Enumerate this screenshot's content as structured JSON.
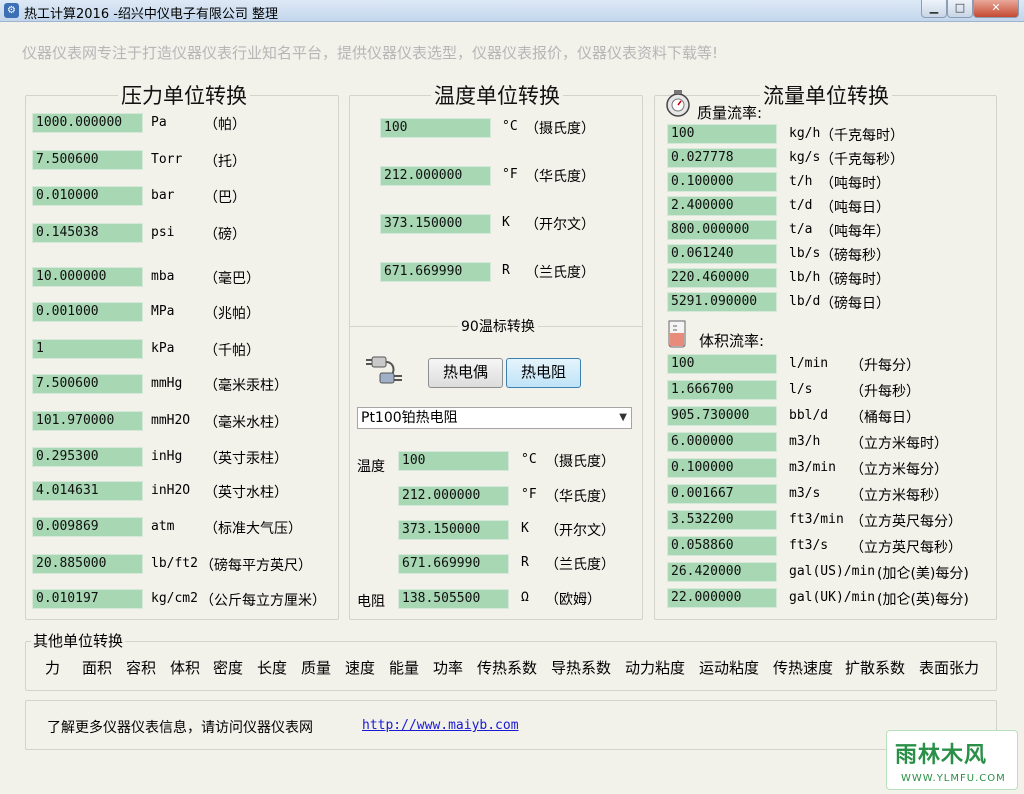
{
  "window": {
    "title": "热工计算2016 -绍兴中仪电子有限公司 整理",
    "app_icon": "gauge-app-icon"
  },
  "tagline": "仪器仪表网专注于打造仪器仪表行业知名平台，提供仪器仪表选型，仪器仪表报价，仪器仪表资料下载等!",
  "pressure": {
    "title": "压力单位转换",
    "rows": [
      {
        "value": "1000.000000",
        "unit": "Pa",
        "name": "（帕）"
      },
      {
        "value": "7.500600",
        "unit": "Torr",
        "name": "（托）"
      },
      {
        "value": "0.010000",
        "unit": "bar",
        "name": "（巴）"
      },
      {
        "value": "0.145038",
        "unit": "psi",
        "name": "（磅）"
      },
      {
        "value": "10.000000",
        "unit": "mba",
        "name": "（毫巴）"
      },
      {
        "value": "0.001000",
        "unit": "MPa",
        "name": "（兆帕）"
      },
      {
        "value": "1",
        "unit": "kPa",
        "name": "（千帕）"
      },
      {
        "value": "7.500600",
        "unit": "mmHg",
        "name": "（毫米汞柱）"
      },
      {
        "value": "101.970000",
        "unit": "mmH2O",
        "name": "（毫米水柱）"
      },
      {
        "value": "0.295300",
        "unit": "inHg",
        "name": "（英寸汞柱）"
      },
      {
        "value": "4.014631",
        "unit": "inH2O",
        "name": "（英寸水柱）"
      },
      {
        "value": "0.009869",
        "unit": "atm",
        "name": "（标准大气压）"
      },
      {
        "value": "20.885000",
        "unit": "lb/ft2",
        "name": "（磅每平方英尺）"
      },
      {
        "value": "0.010197",
        "unit": "kg/cm2",
        "name": "（公斤每立方厘米）"
      }
    ]
  },
  "temperature": {
    "title": "温度单位转换",
    "rows": [
      {
        "value": "100",
        "unit": "°C",
        "name": "（摄氏度）"
      },
      {
        "value": "212.000000",
        "unit": "°F",
        "name": "（华氏度）"
      },
      {
        "value": "373.150000",
        "unit": "K",
        "name": "（开尔文）"
      },
      {
        "value": "671.669990",
        "unit": "R",
        "name": "（兰氏度）"
      }
    ],
    "its90": {
      "title": "90温标转换",
      "icon": "sensor-plug-icon",
      "btn_thermocouple": "热电偶",
      "btn_rtd": "热电阻",
      "sensor_select": "Pt100铂热电阻",
      "temp_label": "温度",
      "resistance_label": "电阻",
      "rows": [
        {
          "value": "100",
          "unit": "°C",
          "name": "（摄氏度）"
        },
        {
          "value": "212.000000",
          "unit": "°F",
          "name": "（华氏度）"
        },
        {
          "value": "373.150000",
          "unit": "K",
          "name": "（开尔文）"
        },
        {
          "value": "671.669990",
          "unit": "R",
          "name": "（兰氏度）"
        },
        {
          "value": "138.505500",
          "unit": "Ω",
          "name": "（欧姆）"
        }
      ]
    }
  },
  "flow": {
    "title": "流量单位转换",
    "mass_label": "质量流率:",
    "mass_icon": "scale-icon",
    "mass_rows": [
      {
        "value": "100",
        "unit": "kg/h",
        "name": "（千克每时）"
      },
      {
        "value": "0.027778",
        "unit": "kg/s",
        "name": "（千克每秒）"
      },
      {
        "value": "0.100000",
        "unit": "t/h",
        "name": "（吨每时）"
      },
      {
        "value": "2.400000",
        "unit": "t/d",
        "name": "（吨每日）"
      },
      {
        "value": "800.000000",
        "unit": "t/a",
        "name": "（吨每年）"
      },
      {
        "value": "0.061240",
        "unit": "lb/s",
        "name": "（磅每秒）"
      },
      {
        "value": "220.460000",
        "unit": "lb/h",
        "name": "（磅每时）"
      },
      {
        "value": "5291.090000",
        "unit": "lb/d",
        "name": "（磅每日）"
      }
    ],
    "volume_label": "体积流率:",
    "volume_icon": "beaker-icon",
    "volume_rows": [
      {
        "value": "100",
        "unit": "l/min",
        "name": "（升每分）"
      },
      {
        "value": "1.666700",
        "unit": "l/s",
        "name": "（升每秒）"
      },
      {
        "value": "905.730000",
        "unit": "bbl/d",
        "name": "（桶每日）"
      },
      {
        "value": "6.000000",
        "unit": "m3/h",
        "name": "（立方米每时）"
      },
      {
        "value": "0.100000",
        "unit": "m3/min",
        "name": "（立方米每分）"
      },
      {
        "value": "0.001667",
        "unit": "m3/s",
        "name": "（立方米每秒）"
      },
      {
        "value": "3.532200",
        "unit": "ft3/min",
        "name": "（立方英尺每分）"
      },
      {
        "value": "0.058860",
        "unit": "ft3/s",
        "name": "（立方英尺每秒）"
      },
      {
        "value": "26.420000",
        "unit": "gal(US)/min",
        "name": "(加仑(美)每分)"
      },
      {
        "value": "22.000000",
        "unit": "gal(UK)/min",
        "name": "(加仑(英)每分)"
      }
    ]
  },
  "other": {
    "title": "其他单位转换",
    "items": [
      "力",
      "面积",
      "容积",
      "体积",
      "密度",
      "长度",
      "质量",
      "速度",
      "能量",
      "功率",
      "传热系数",
      "导热系数",
      "动力粘度",
      "运动粘度",
      "传热速度",
      "扩散系数",
      "表面张力"
    ]
  },
  "footer": {
    "text": "了解更多仪器仪表信息，请访问仪器仪表网",
    "link": "http://www.maiyb.com"
  },
  "watermark": {
    "text": "雨林木风",
    "url": "WWW.YLMFU.COM"
  }
}
